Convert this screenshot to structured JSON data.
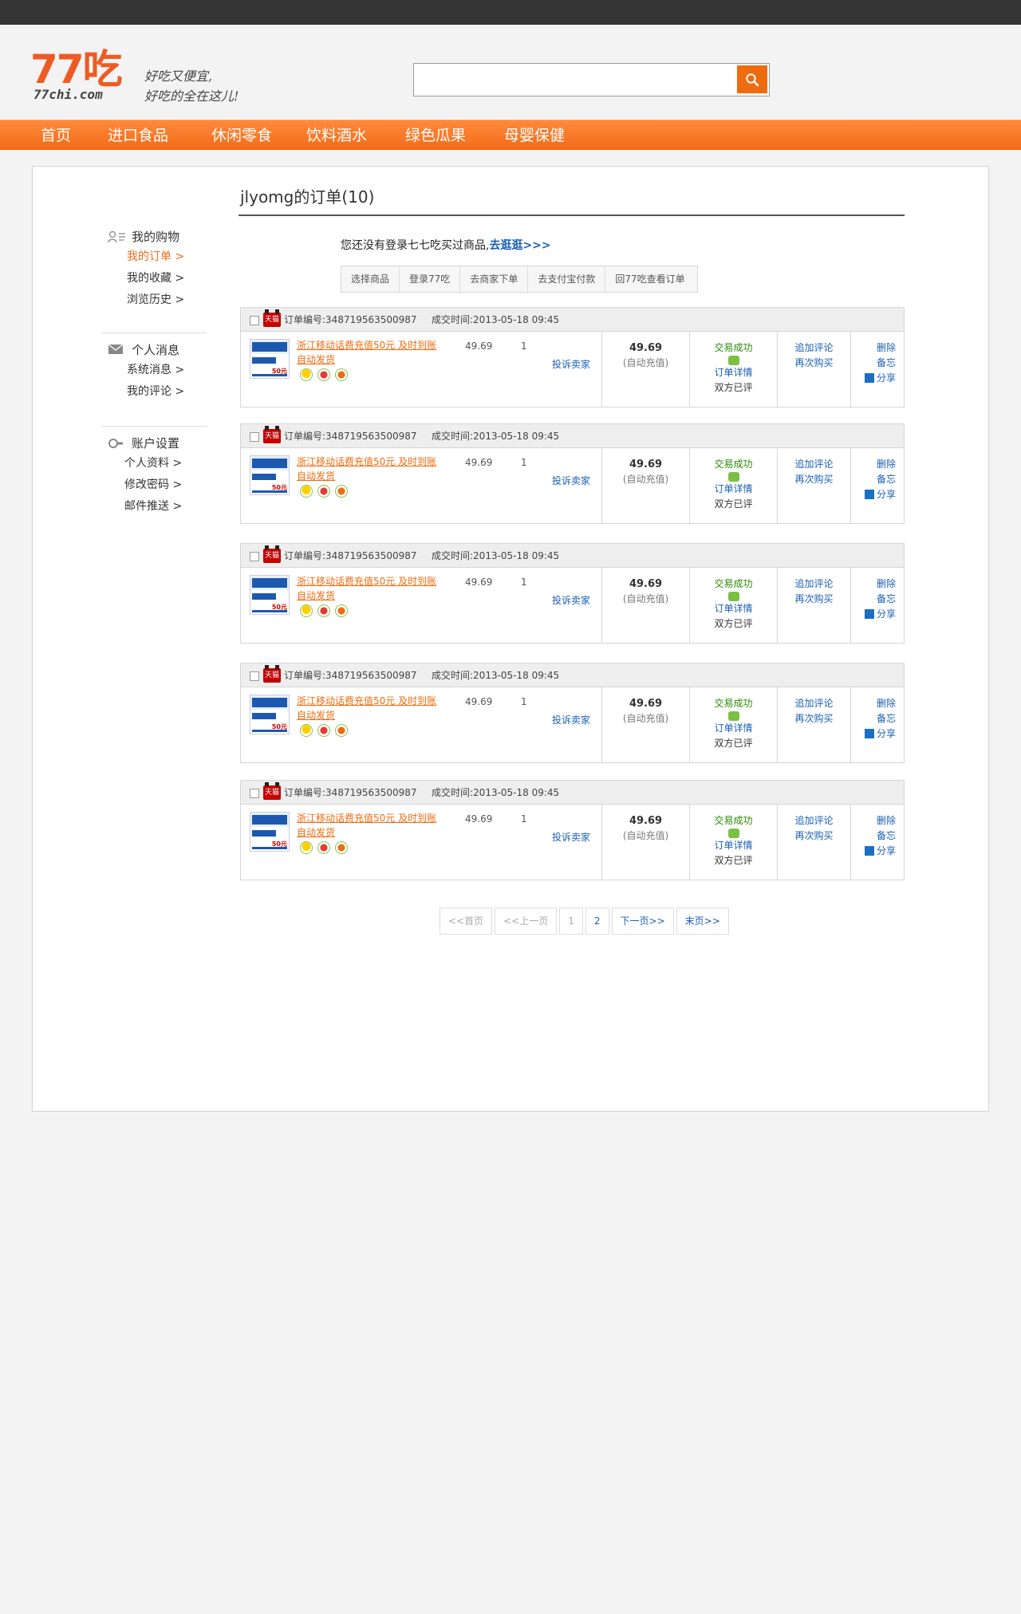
{
  "site": {
    "logo_number": "77吃",
    "logo_url": "77chi.com",
    "slogan_line1": "好吃又便宜,",
    "slogan_line2": "好吃的全在这儿!"
  },
  "search": {
    "placeholder": "",
    "value": ""
  },
  "nav": [
    "首页",
    "进口食品",
    "休闲零食",
    "饮料酒水",
    "绿色瓜果",
    "母婴保健"
  ],
  "sidebar": {
    "shopping": {
      "title": "我的购物",
      "links": [
        "我的订单 >",
        "我的收藏 >",
        "浏览历史 >"
      ]
    },
    "messages": {
      "title": "个人消息",
      "links": [
        "系统消息 >",
        "我的评论 >"
      ]
    },
    "account": {
      "title": "账户设置",
      "links": [
        "个人资料 >",
        "修改密码 >",
        "邮件推送 >"
      ]
    }
  },
  "page": {
    "title": "jlyomg的订单(10)",
    "notice_text": "您还没有登录七七吃买过商品,",
    "notice_link": "去逛逛>>>",
    "steps": [
      "选择商品",
      "登录77吃",
      "去商家下单",
      "去支付宝付款",
      "回77吃查看订单"
    ]
  },
  "order_labels": {
    "tmall": "天猫",
    "order_no_label": "订单编号:",
    "time_label": "成交时间:",
    "complain": "投诉卖家",
    "auto_recharge": "(自动充值)",
    "status": "交易成功",
    "detail": "订单详情",
    "reviewed": "双方已评",
    "add_review": "追加评论",
    "buy_again": "再次购买",
    "delete": "删除",
    "memo": "备忘",
    "share": "分享"
  },
  "orders": [
    {
      "order_no": "348719563500987",
      "time": "2013-05-18 09:45",
      "product": "浙江移动话费充值50元 及时到账 自动发货",
      "price": "49.69",
      "qty": "1",
      "amount": "49.69"
    },
    {
      "order_no": "348719563500987",
      "time": "2013-05-18 09:45",
      "product": "浙江移动话费充值50元 及时到账 自动发货",
      "price": "49.69",
      "qty": "1",
      "amount": "49.69"
    },
    {
      "order_no": "348719563500987",
      "time": "2013-05-18 09:45",
      "product": "浙江移动话费充值50元 及时到账 自动发货",
      "price": "49.69",
      "qty": "1",
      "amount": "49.69"
    },
    {
      "order_no": "348719563500987",
      "time": "2013-05-18 09:45",
      "product": "浙江移动话费充值50元 及时到账 自动发货",
      "price": "49.69",
      "qty": "1",
      "amount": "49.69"
    },
    {
      "order_no": "348719563500987",
      "time": "2013-05-18 09:45",
      "product": "浙江移动话费充值50元 及时到账 自动发货",
      "price": "49.69",
      "qty": "1",
      "amount": "49.69"
    }
  ],
  "product_thumb": {
    "brand": "中国移动通信",
    "label": "面值",
    "region": "浙江",
    "face_value": "50元"
  },
  "pager": [
    "<<首页",
    "<<上一页",
    "1",
    "2",
    "下一页>>",
    "末页>>"
  ],
  "colors": {
    "accent": "#f26b18",
    "link": "#1a5fb4",
    "success": "#2a8a00"
  }
}
